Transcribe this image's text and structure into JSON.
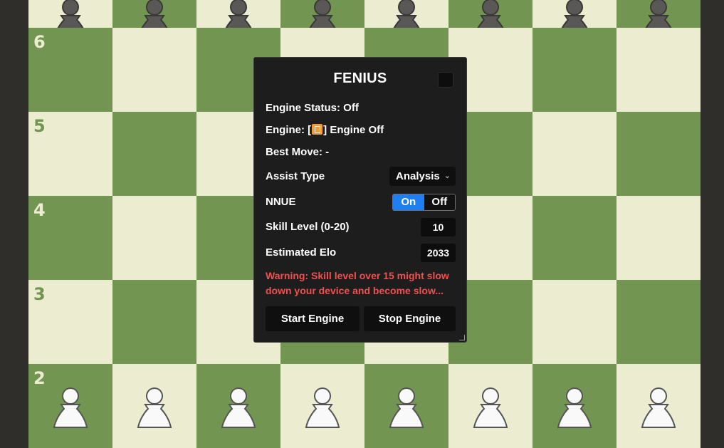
{
  "board": {
    "light_color": "#ebecd0",
    "dark_color": "#739552",
    "ranks": [
      {
        "label": "",
        "pieces": "black-pawns"
      },
      {
        "label": "6",
        "pieces": ""
      },
      {
        "label": "5",
        "pieces": ""
      },
      {
        "label": "4",
        "pieces": ""
      },
      {
        "label": "3",
        "pieces": ""
      },
      {
        "label": "2",
        "pieces": "white-pawns"
      }
    ]
  },
  "rank_labels": {
    "r6": "6",
    "r5": "5",
    "r4": "4",
    "r3": "3",
    "r2": "2"
  },
  "panel": {
    "title": "FENIUS",
    "engine_status": "Engine Status: Off",
    "engine_prefix": "Engine: [",
    "engine_icon": "engine-badge-icon",
    "engine_suffix": "] Engine Off",
    "best_move": "Best Move: -",
    "assist_type_label": "Assist Type",
    "assist_type_value": "Analysis",
    "nnue_label": "NNUE",
    "nnue_on": "On",
    "nnue_off": "Off",
    "nnue_selected": "On",
    "skill_label": "Skill Level (0-20)",
    "skill_value": "10",
    "elo_label": "Estimated Elo",
    "elo_value": "2033",
    "warning": "Warning: Skill level over 15 might slow down your device and become slow...",
    "start_button": "Start Engine",
    "stop_button": "Stop Engine",
    "accent_color": "#1f7ff2",
    "warning_color": "#f05050"
  }
}
